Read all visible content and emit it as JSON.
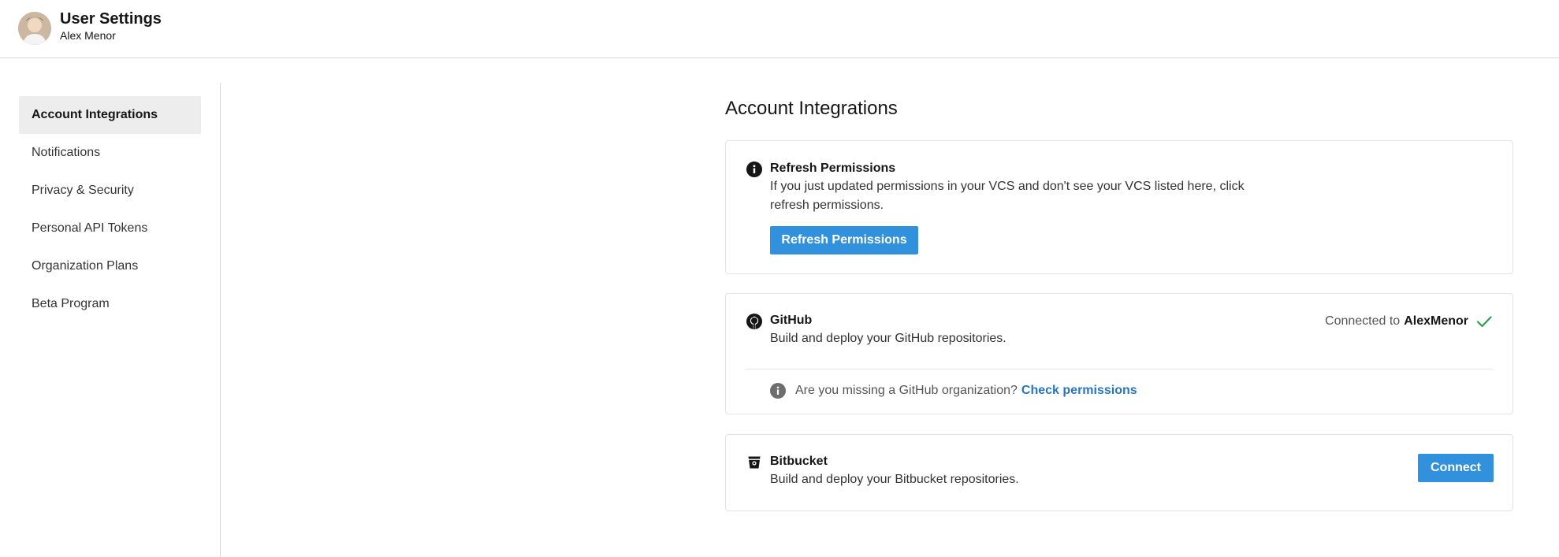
{
  "header": {
    "title": "User Settings",
    "subtitle": "Alex Menor"
  },
  "sidebar": {
    "items": [
      {
        "label": "Account Integrations",
        "active": true
      },
      {
        "label": "Notifications",
        "active": false
      },
      {
        "label": "Privacy & Security",
        "active": false
      },
      {
        "label": "Personal API Tokens",
        "active": false
      },
      {
        "label": "Organization Plans",
        "active": false
      },
      {
        "label": "Beta Program",
        "active": false
      }
    ]
  },
  "main": {
    "title": "Account Integrations",
    "refresh_card": {
      "icon": "info-icon",
      "title": "Refresh Permissions",
      "text": "If you just updated permissions in your VCS and don't see your VCS listed here, click refresh permissions.",
      "button_label": "Refresh Permissions"
    },
    "github_card": {
      "icon": "github-icon",
      "title": "GitHub",
      "text": "Build and deploy your GitHub repositories.",
      "connected_prefix": "Connected to",
      "connected_user": "AlexMenor",
      "status_icon": "check-icon",
      "missing_text": "Are you missing a GitHub organization?",
      "missing_link": "Check permissions"
    },
    "bitbucket_card": {
      "icon": "bitbucket-icon",
      "title": "Bitbucket",
      "text": "Build and deploy your Bitbucket repositories.",
      "button_label": "Connect"
    }
  },
  "colors": {
    "accent": "#3291dc",
    "link": "#2a75c0",
    "success": "#2e9e4f",
    "active_bg": "#ededed"
  }
}
